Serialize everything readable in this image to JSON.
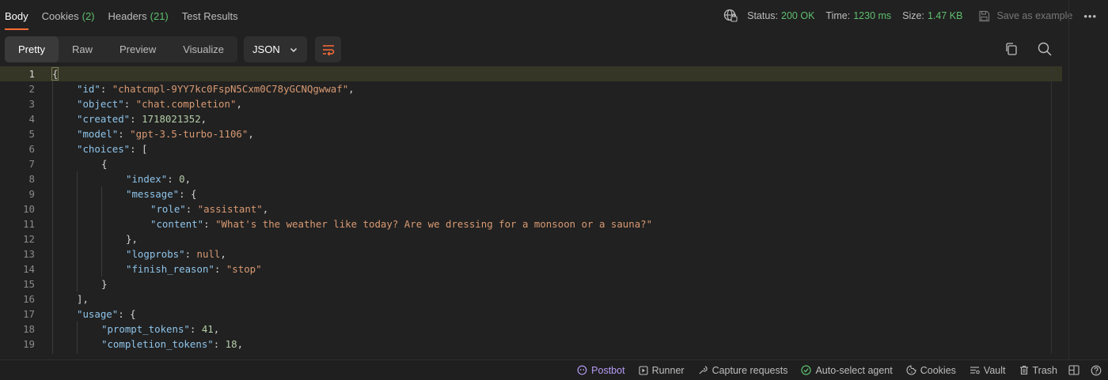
{
  "tabs": [
    {
      "label": "Body",
      "count": ""
    },
    {
      "label": "Cookies",
      "count": "(2)"
    },
    {
      "label": "Headers",
      "count": "(21)"
    },
    {
      "label": "Test Results",
      "count": ""
    }
  ],
  "status": {
    "status_label": "Status:",
    "status_value": "200 OK",
    "time_label": "Time:",
    "time_value": "1230 ms",
    "size_label": "Size:",
    "size_value": "1.47 KB",
    "save_label": "Save as example",
    "more_label": "•••"
  },
  "view_modes": [
    "Pretty",
    "Raw",
    "Preview",
    "Visualize"
  ],
  "format": {
    "selected": "JSON"
  },
  "editor": {
    "lines": [
      {
        "num": "1"
      },
      {
        "num": "2"
      },
      {
        "num": "3"
      },
      {
        "num": "4"
      },
      {
        "num": "5"
      },
      {
        "num": "6"
      },
      {
        "num": "7"
      },
      {
        "num": "8"
      },
      {
        "num": "9"
      },
      {
        "num": "10"
      },
      {
        "num": "11"
      },
      {
        "num": "12"
      },
      {
        "num": "13"
      },
      {
        "num": "14"
      },
      {
        "num": "15"
      },
      {
        "num": "16"
      },
      {
        "num": "17"
      },
      {
        "num": "18"
      },
      {
        "num": "19"
      }
    ],
    "tokens": {
      "k_id": "\"id\"",
      "v_id": "\"chatcmpl-9YY7kc0FspN5Cxm0C78yGCNQgwwaf\"",
      "k_object": "\"object\"",
      "v_object": "\"chat.completion\"",
      "k_created": "\"created\"",
      "v_created": "1718021352",
      "k_model": "\"model\"",
      "v_model": "\"gpt-3.5-turbo-1106\"",
      "k_choices": "\"choices\"",
      "k_index": "\"index\"",
      "v_index": "0",
      "k_message": "\"message\"",
      "k_role": "\"role\"",
      "v_role": "\"assistant\"",
      "k_content": "\"content\"",
      "v_content": "\"What's the weather like today? Are we dressing for a monsoon or a sauna?\"",
      "k_logprobs": "\"logprobs\"",
      "v_logprobs": "null",
      "k_finish": "\"finish_reason\"",
      "v_finish": "\"stop\"",
      "k_usage": "\"usage\"",
      "k_prompt": "\"prompt_tokens\"",
      "v_prompt": "41",
      "k_completion": "\"completion_tokens\"",
      "v_completion": "18"
    }
  },
  "bottom_bar": {
    "postbot": "Postbot",
    "runner": "Runner",
    "capture": "Capture requests",
    "agent": "Auto-select agent",
    "cookies": "Cookies",
    "vault": "Vault",
    "trash": "Trash"
  },
  "colors": {
    "accent": "#ff6c37",
    "status_green": "#5fbf6f",
    "json_key": "#8fc4ea",
    "json_string": "#d99a73",
    "json_number": "#b5cea8",
    "postbot": "#b79cf6"
  }
}
